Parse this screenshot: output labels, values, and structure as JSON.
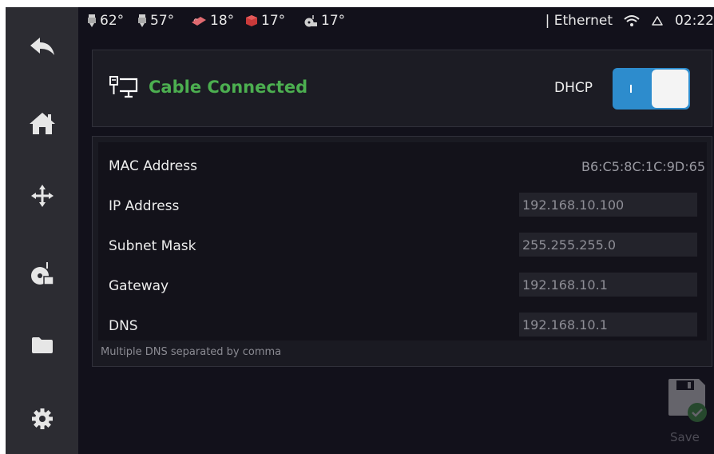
{
  "status": {
    "temps": [
      {
        "name": "extruder",
        "icon": "extruder-icon",
        "value": "62°"
      },
      {
        "name": "extruder1",
        "icon": "extruder-icon",
        "value": "57°"
      },
      {
        "name": "bed",
        "icon": "heater-bed-icon",
        "value": "18°"
      },
      {
        "name": "chamber",
        "icon": "chamber-icon",
        "value": "17°"
      },
      {
        "name": "mcu",
        "icon": "mcu-icon",
        "value": "17°"
      }
    ],
    "network": "| Ethernet",
    "time": "02:22"
  },
  "sidebar": {
    "items": [
      {
        "name": "back",
        "icon": "back-arrow-icon"
      },
      {
        "name": "home",
        "icon": "home-icon"
      },
      {
        "name": "move",
        "icon": "move-icon"
      },
      {
        "name": "filament",
        "icon": "filament-spool-icon"
      },
      {
        "name": "files",
        "icon": "folder-icon"
      },
      {
        "name": "settings",
        "icon": "gear-icon"
      }
    ]
  },
  "connection": {
    "status": "Cable Connected",
    "dhcp_label": "DHCP",
    "dhcp_enabled": true
  },
  "network_info": {
    "mac_label": "MAC Address",
    "mac_value": "B6:C5:8C:1C:9D:65",
    "fields": [
      {
        "label": "IP Address",
        "value": "192.168.10.100"
      },
      {
        "label": "Subnet Mask",
        "value": "255.255.255.0"
      },
      {
        "label": "Gateway",
        "value": "192.168.10.1"
      },
      {
        "label": "DNS",
        "value": "192.168.10.1"
      }
    ],
    "hint": "Multiple DNS separated by comma"
  },
  "actions": {
    "save_label": "Save"
  },
  "colors": {
    "connected": "#4caf50",
    "toggle_on": "#2d8ccd",
    "sidebar_bg": "#2c2c32",
    "screen_bg": "#12111b"
  }
}
